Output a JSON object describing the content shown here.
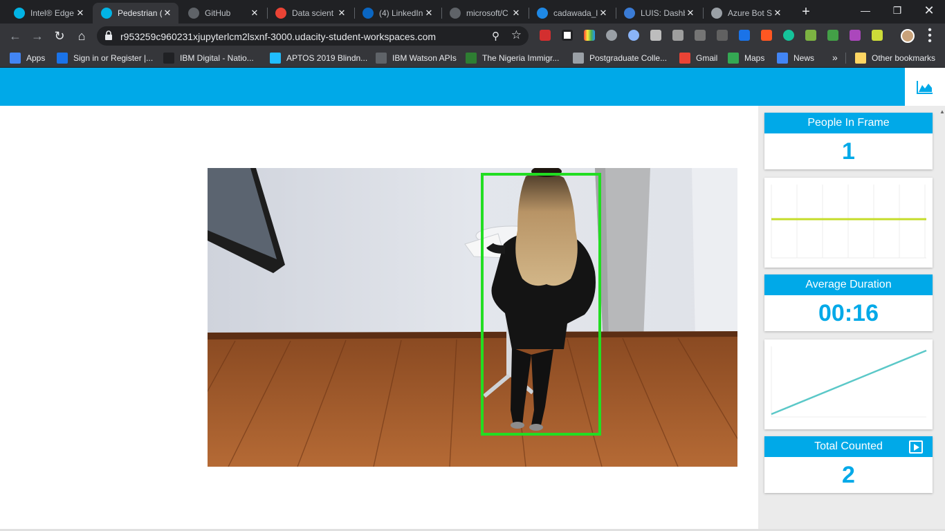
{
  "browser": {
    "tabs": [
      {
        "title": "Intel® Edge",
        "icon": "udacity-icon",
        "color": "#02b3e4",
        "active": false
      },
      {
        "title": "Pedestrian (",
        "icon": "udacity-icon",
        "color": "#02b3e4",
        "active": true
      },
      {
        "title": "GitHub",
        "icon": "github-icon",
        "color": "#5f6368",
        "active": false
      },
      {
        "title": "Data scient",
        "icon": "gmail-icon",
        "color": "#ea4335",
        "active": false
      },
      {
        "title": "(4) LinkedIn",
        "icon": "linkedin-icon",
        "color": "#0a66c2",
        "active": false
      },
      {
        "title": "microsoft/C",
        "icon": "github-icon",
        "color": "#5f6368",
        "active": false
      },
      {
        "title": "cadawada_l",
        "icon": "azure-icon",
        "color": "#1e88e5",
        "active": false
      },
      {
        "title": "LUIS: Dashb",
        "icon": "luis-icon",
        "color": "#3a7bd5",
        "active": false
      },
      {
        "title": "Azure Bot S",
        "icon": "globe-icon",
        "color": "#9aa0a6",
        "active": false
      }
    ],
    "url": "r953259c960231xjupyterlcm2lsxnf-3000.udacity-student-workspaces.com",
    "bookmarks": [
      {
        "label": "Apps",
        "icon": "apps-grid-icon",
        "color": "#4285f4"
      },
      {
        "label": "Sign in or Register |...",
        "icon": "signin-icon",
        "color": "#1a73e8"
      },
      {
        "label": "IBM Digital - Natio...",
        "icon": "africa-map-icon",
        "color": "#202124"
      },
      {
        "label": "APTOS 2019 Blindn...",
        "icon": "kaggle-icon",
        "color": "#20beff"
      },
      {
        "label": "IBM Watson APIs",
        "icon": "github-icon",
        "color": "#5f6368"
      },
      {
        "label": "The Nigeria Immigr...",
        "icon": "nigeria-crest-icon",
        "color": "#2e7d32"
      },
      {
        "label": "Postgraduate Colle...",
        "icon": "globe-icon",
        "color": "#9aa0a6"
      },
      {
        "label": "Gmail",
        "icon": "gmail-icon",
        "color": "#ea4335"
      },
      {
        "label": "Maps",
        "icon": "maps-icon",
        "color": "#34a853"
      },
      {
        "label": "News",
        "icon": "news-icon",
        "color": "#4285f4"
      }
    ],
    "bookmarks_more": "»",
    "other_bookmarks": "Other bookmarks"
  },
  "dashboard": {
    "people_in_frame": {
      "label": "People In Frame",
      "value": "1"
    },
    "average_duration": {
      "label": "Average Duration",
      "value": "00:16"
    },
    "total_counted": {
      "label": "Total Counted",
      "value": "2"
    },
    "people_chart_color": "#c5dc2a",
    "duration_chart_color": "#5bc8c8",
    "accent_color": "#00a9e8",
    "detection_box_color": "#22dd22"
  }
}
